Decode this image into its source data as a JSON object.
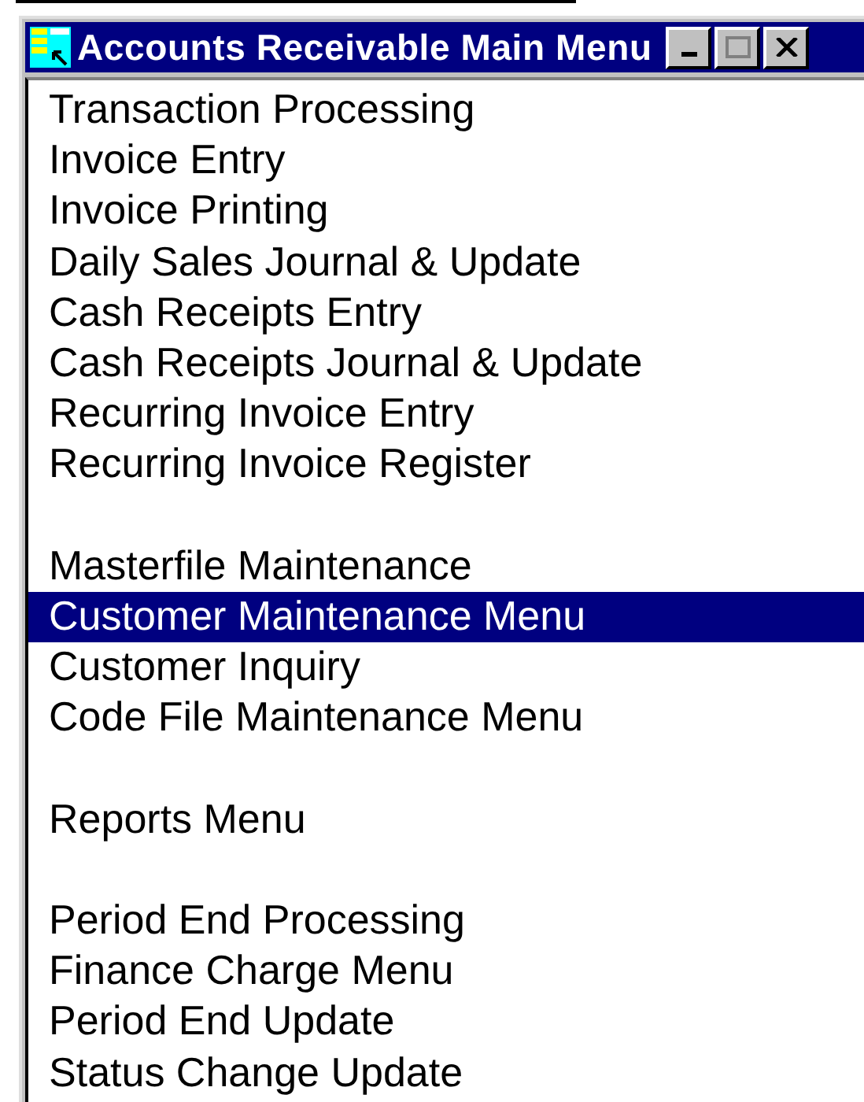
{
  "window": {
    "title": "Accounts Receivable Main Menu"
  },
  "menu": [
    {
      "kind": "item",
      "label": "Transaction Processing",
      "selected": false
    },
    {
      "kind": "item",
      "label": "Invoice Entry",
      "selected": false
    },
    {
      "kind": "item",
      "label": "Invoice Printing",
      "selected": false
    },
    {
      "kind": "item",
      "label": "Daily Sales Journal & Update",
      "selected": false
    },
    {
      "kind": "item",
      "label": "Cash Receipts Entry",
      "selected": false
    },
    {
      "kind": "item",
      "label": "Cash Receipts Journal & Update",
      "selected": false
    },
    {
      "kind": "item",
      "label": "Recurring Invoice Entry",
      "selected": false
    },
    {
      "kind": "item",
      "label": "Recurring Invoice Register",
      "selected": false
    },
    {
      "kind": "gap"
    },
    {
      "kind": "item",
      "label": "Masterfile Maintenance",
      "selected": false
    },
    {
      "kind": "item",
      "label": "Customer Maintenance Menu",
      "selected": true
    },
    {
      "kind": "item",
      "label": "Customer Inquiry",
      "selected": false
    },
    {
      "kind": "item",
      "label": "Code File Maintenance Menu",
      "selected": false
    },
    {
      "kind": "gap"
    },
    {
      "kind": "item",
      "label": "Reports Menu",
      "selected": false
    },
    {
      "kind": "gap"
    },
    {
      "kind": "item",
      "label": "Period End Processing",
      "selected": false
    },
    {
      "kind": "item",
      "label": "Finance Charge Menu",
      "selected": false
    },
    {
      "kind": "item",
      "label": "Period End Update",
      "selected": false
    },
    {
      "kind": "item",
      "label": "Status Change Update",
      "selected": false
    }
  ]
}
